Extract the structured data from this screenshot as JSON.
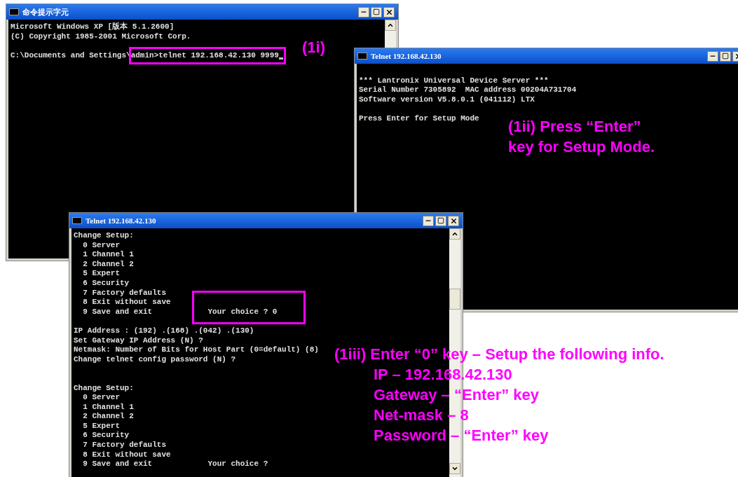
{
  "windows": [
    {
      "title": "命令提示字元",
      "lines": [
        {
          "text": "Microsoft Windows XP [版本 5.1.2600]"
        },
        {
          "text": "(C) Copyright 1985-2001 Microsoft Corp."
        },
        {
          "kind": "blank"
        },
        {
          "segments": [
            {
              "text": "C:\\Documents and Settings\\",
              "highlighted": false
            },
            {
              "text": "admin>telnet 192.168.42.130 9999",
              "highlighted": true
            }
          ],
          "cursor": true
        }
      ]
    },
    {
      "title": "Telnet 192.168.42.130",
      "lines": [
        {
          "kind": "blank"
        },
        {
          "text": "*** Lantronix Universal Device Server ***"
        },
        {
          "text": "Serial Number 7305892  MAC address 00204A731704"
        },
        {
          "text": "Software version V5.8.0.1 (041112) LTX"
        },
        {
          "kind": "blank"
        },
        {
          "text": "Press Enter for Setup Mode"
        }
      ]
    },
    {
      "title": "Telnet 192.168.42.130",
      "lines": [
        {
          "text": "Change Setup:"
        },
        {
          "text": "  0 Server"
        },
        {
          "text": "  1 Channel 1"
        },
        {
          "text": "  2 Channel 2"
        },
        {
          "text": "  5 Expert"
        },
        {
          "text": "  6 Security"
        },
        {
          "text": "  7 Factory defaults"
        },
        {
          "text": "  8 Exit without save"
        },
        {
          "segments": [
            {
              "text": "  9 Save and exit            ",
              "highlighted": false
            },
            {
              "text": "Your choice ? 0",
              "highlighted": true
            }
          ]
        },
        {
          "kind": "blank"
        },
        {
          "text": "IP Address : (192) .(168) .(042) .(130)"
        },
        {
          "text": "Set Gateway IP Address (N) ?"
        },
        {
          "text": "Netmask: Number of Bits for Host Part (0=default) (8)"
        },
        {
          "text": "Change telnet config password (N) ?"
        },
        {
          "kind": "blank"
        },
        {
          "kind": "blank"
        },
        {
          "text": "Change Setup:"
        },
        {
          "text": "  0 Server"
        },
        {
          "text": "  1 Channel 1"
        },
        {
          "text": "  2 Channel 2"
        },
        {
          "text": "  5 Expert"
        },
        {
          "text": "  6 Security"
        },
        {
          "text": "  7 Factory defaults"
        },
        {
          "text": "  8 Exit without save"
        },
        {
          "text": "  9 Save and exit            Your choice ?"
        }
      ]
    }
  ],
  "annotations": [
    {
      "lines": [
        "(1i)"
      ]
    },
    {
      "lines": [
        "(1ii) Press “Enter”",
        "key for Setup Mode."
      ]
    },
    {
      "lines": [
        "(1iii) Enter “0” key – Setup the following info.",
        "IP – 192.168.42.130",
        "Gateway – “Enter” key",
        "Net-mask – 8",
        "Password – “Enter” key"
      ]
    }
  ]
}
